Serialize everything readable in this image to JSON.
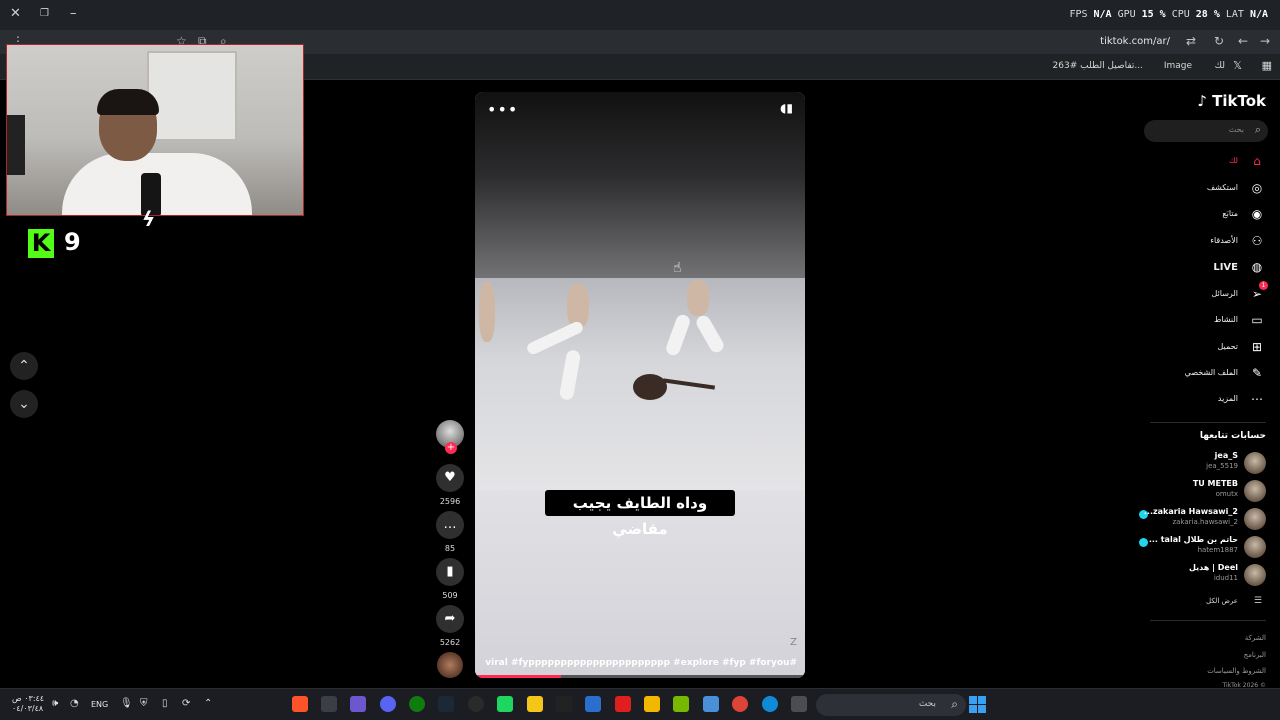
{
  "browser": {
    "url": "tiktok.com/ar/",
    "overlay": {
      "fps_label": "FPS",
      "fps": "N/A",
      "gpu_label": "GPU",
      "gpu": "15 %",
      "cpu_label": "CPU",
      "cpu": "28 %",
      "lat_label": "LAT",
      "lat": "N/A"
    },
    "bookmarks": [
      "تفاصيل الطلب #263...",
      "لك",
      "Image"
    ]
  },
  "stream_overlay": {
    "kick_count": "9"
  },
  "video": {
    "caption": "وداه الطايف يجيب مقاضي",
    "hashtags": "#viral #fypppppppppppppppppppppp #explore #fyp #foryou",
    "watermark": "Z",
    "progress_fraction": 0.26
  },
  "actions": {
    "likes": "2596",
    "comments": "85",
    "saves": "509",
    "shares": "5262"
  },
  "sidebar": {
    "brand": "TikTok",
    "search_placeholder": "بحث",
    "nav": [
      {
        "label": "لك",
        "icon": "home-icon",
        "active": true
      },
      {
        "label": "استكشف",
        "icon": "compass-icon"
      },
      {
        "label": "متابَع",
        "icon": "avatar-icon"
      },
      {
        "label": "الأصدقاء",
        "icon": "friends-icon"
      },
      {
        "label": "LIVE",
        "icon": "live-icon"
      },
      {
        "label": "الرسائل",
        "icon": "messages-icon",
        "badge": "1"
      },
      {
        "label": "النشاط",
        "icon": "activity-icon"
      },
      {
        "label": "تحميل",
        "icon": "upload-icon"
      },
      {
        "label": "الملف الشخصي",
        "icon": "profile-icon"
      },
      {
        "label": "المزيد",
        "icon": "more-icon"
      }
    ],
    "following_title": "حسابات تتابعها",
    "following": [
      {
        "name": "jea_S",
        "user": "jea_5519"
      },
      {
        "name": "TU METEB",
        "user": "omutx"
      },
      {
        "name": "zakaria Hawsawi_2...",
        "user": "zakaria.hawsawi_2"
      },
      {
        "name": "حاتم بن طلال talal ...",
        "user": "hatem1887"
      },
      {
        "name": "Deel | هديل",
        "user": "idud11"
      }
    ],
    "see_all": "عرض الكل",
    "footer": [
      "الشركة",
      "البرنامج",
      "الشروط والسياسات",
      "© TikTok 2026"
    ]
  },
  "taskbar": {
    "time": "٠٣:٤٤ ص",
    "date": "٠٤/٠٣/٤٨",
    "lang": "ENG",
    "search_placeholder": "بحث"
  },
  "colors": {
    "accent": "#fe2c55",
    "kick": "#53fc18",
    "live": "#20d5ec"
  }
}
